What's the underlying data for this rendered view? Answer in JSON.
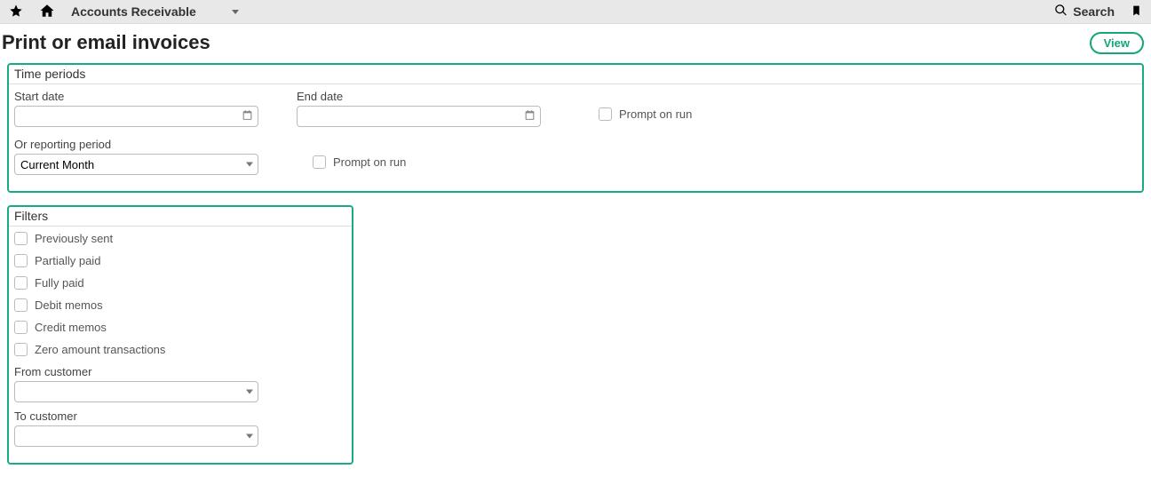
{
  "topbar": {
    "module_label": "Accounts Receivable",
    "search_label": "Search"
  },
  "page": {
    "title": "Print or email invoices",
    "view_button": "View"
  },
  "time_periods": {
    "title": "Time periods",
    "start_date_label": "Start date",
    "start_date_value": "",
    "end_date_label": "End date",
    "end_date_value": "",
    "prompt_on_run_1": "Prompt on run",
    "or_reporting_label": "Or reporting period",
    "reporting_value": "Current Month",
    "prompt_on_run_2": "Prompt on run"
  },
  "filters": {
    "title": "Filters",
    "items": [
      "Previously sent",
      "Partially paid",
      "Fully paid",
      "Debit memos",
      "Credit memos",
      "Zero amount transactions"
    ],
    "from_customer_label": "From customer",
    "from_customer_value": "",
    "to_customer_label": "To customer",
    "to_customer_value": ""
  }
}
